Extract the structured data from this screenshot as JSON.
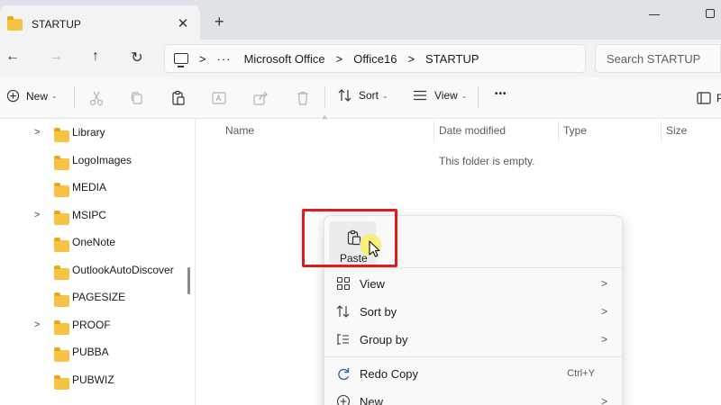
{
  "window": {
    "tab_title": "STARTUP",
    "tab_close": "✕",
    "new_tab": "+"
  },
  "nav": {
    "back": "←",
    "forward": "→",
    "up": "↑",
    "refresh": "↻"
  },
  "address": {
    "more": "···",
    "separator": ">",
    "crumbs": [
      "Microsoft Office",
      "Office16",
      "STARTUP"
    ]
  },
  "search": {
    "placeholder": "Search STARTUP"
  },
  "toolbar": {
    "new_label": "New",
    "sort_label": "Sort",
    "view_label": "View",
    "more_label": "•••",
    "caret": "⌄"
  },
  "tree": {
    "items": [
      {
        "label": "Library",
        "expandable": true
      },
      {
        "label": "LogoImages",
        "expandable": false
      },
      {
        "label": "MEDIA",
        "expandable": false
      },
      {
        "label": "MSIPC",
        "expandable": true
      },
      {
        "label": "OneNote",
        "expandable": false
      },
      {
        "label": "OutlookAutoDiscover",
        "expandable": false
      },
      {
        "label": "PAGESIZE",
        "expandable": false
      },
      {
        "label": "PROOF",
        "expandable": true
      },
      {
        "label": "PUBBA",
        "expandable": false
      },
      {
        "label": "PUBWIZ",
        "expandable": false
      }
    ],
    "chevron": ">"
  },
  "content": {
    "columns": [
      "Name",
      "Date modified",
      "Type",
      "Size"
    ],
    "sort_caret": "^",
    "empty_message": "This folder is empty."
  },
  "context_menu": {
    "paste_label": "Paste",
    "items": [
      {
        "label": "View",
        "arrow": ">",
        "shortcut": ""
      },
      {
        "label": "Sort by",
        "arrow": ">",
        "shortcut": ""
      },
      {
        "label": "Group by",
        "arrow": ">",
        "shortcut": ""
      },
      {
        "label": "Redo Copy",
        "arrow": "",
        "shortcut": "Ctrl+Y"
      },
      {
        "label": "New",
        "arrow": ">",
        "shortcut": ""
      }
    ]
  },
  "colors": {
    "accent": "#e21a1a",
    "folder": "#f6c342",
    "cursor_highlight": "#f8ef6a"
  }
}
